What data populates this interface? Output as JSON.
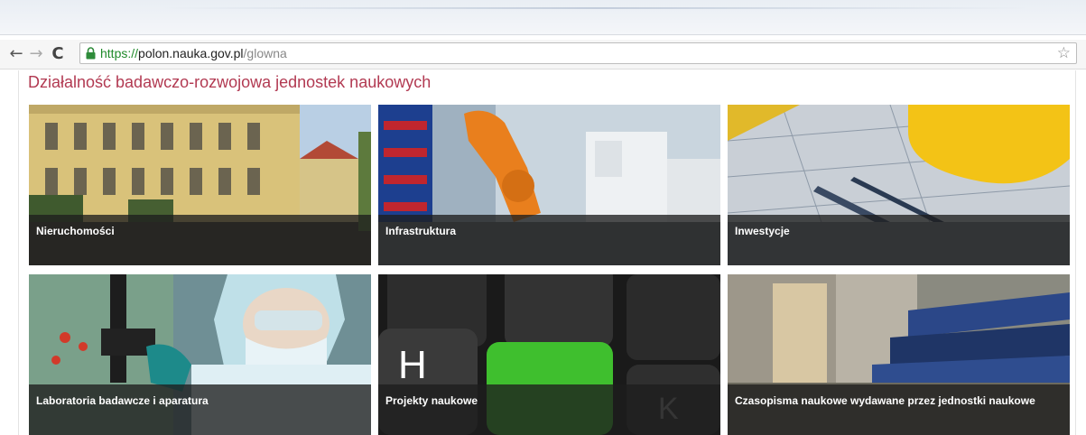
{
  "browser": {
    "url_scheme": "https://",
    "url_domain": "polon.nauka.gov.pl",
    "url_path": "/glowna",
    "icons": [
      "back-arrow-icon",
      "forward-arrow-icon",
      "reload-icon",
      "lock-icon",
      "star-icon"
    ],
    "secure_color": "#1f8a2a"
  },
  "page": {
    "title": "Działalność badawczo-rozwojowa jednostek naukowych",
    "title_color": "#b23a52"
  },
  "tiles": [
    {
      "label": "Nieruchomości"
    },
    {
      "label": "Infrastruktura"
    },
    {
      "label": "Inwestycje"
    },
    {
      "label": "Laboratoria badawcze i aparatura"
    },
    {
      "label": "Projekty naukowe"
    },
    {
      "label": "Czasopisma naukowe wydawane przez jednostki naukowe"
    }
  ]
}
